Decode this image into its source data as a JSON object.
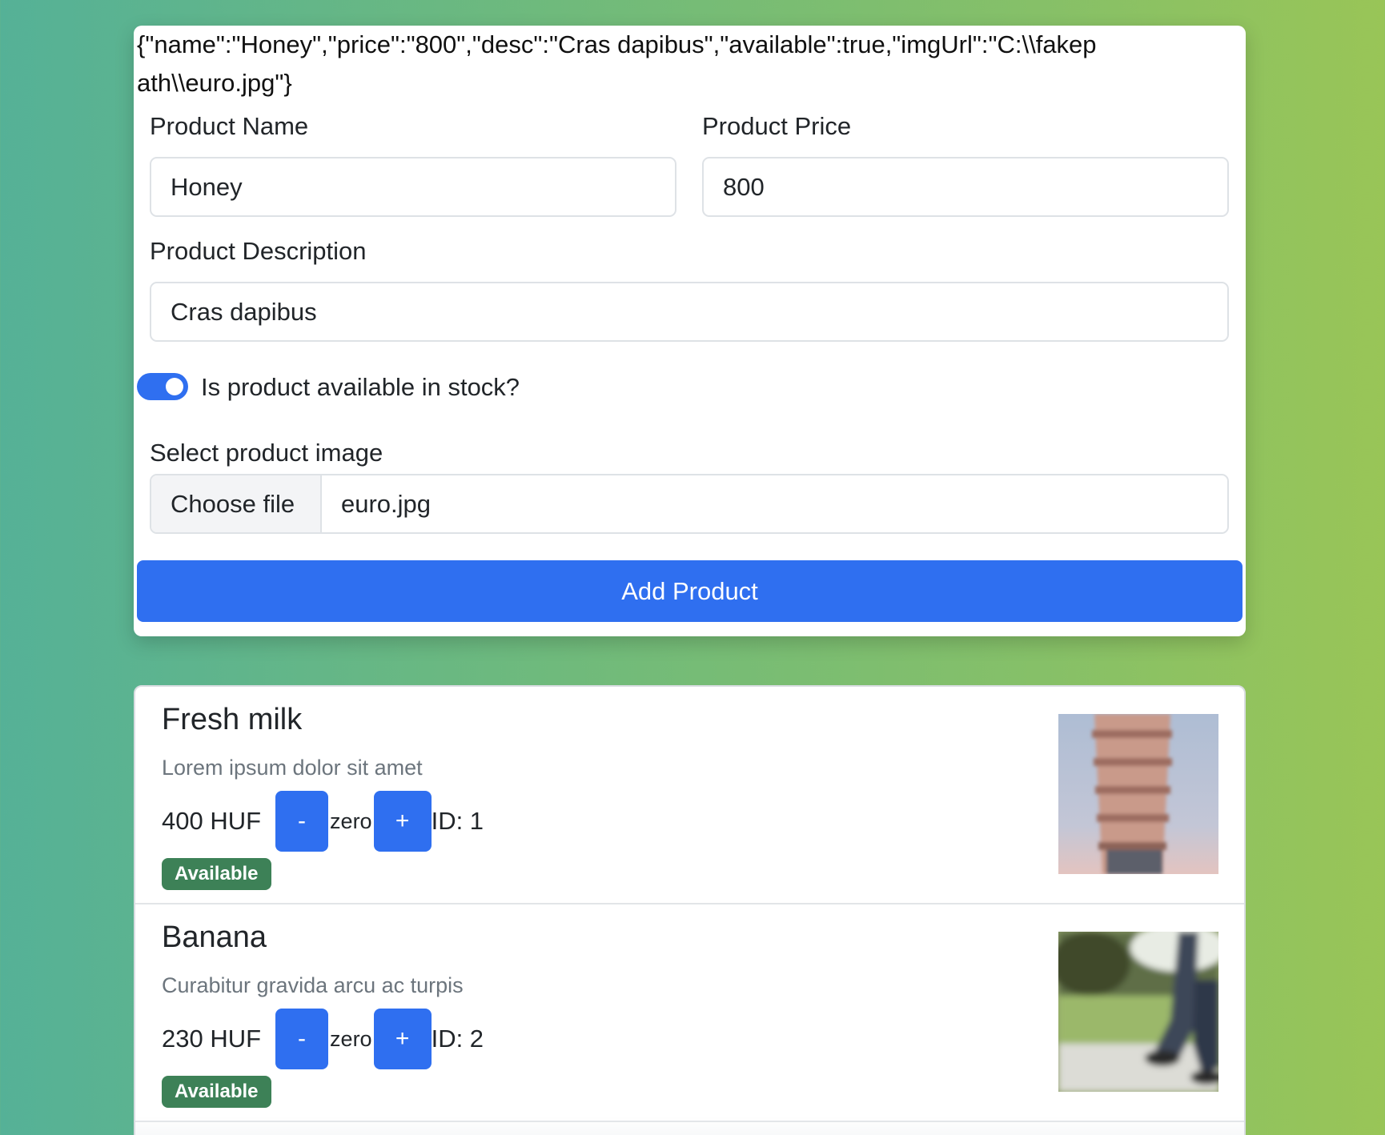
{
  "debug_json": "{\"name\":\"Honey\",\"price\":\"800\",\"desc\":\"Cras dapibus\",\"available\":true,\"imgUrl\":\"C:\\\\fakepath\\\\euro.jpg\"}",
  "form": {
    "name_label": "Product Name",
    "name_value": "Honey",
    "price_label": "Product Price",
    "price_value": "800",
    "desc_label": "Product Description",
    "desc_value": "Cras dapibus",
    "available_label": "Is product available in stock?",
    "available_checked": true,
    "image_label": "Select product image",
    "choose_file_label": "Choose file",
    "file_name": "euro.jpg",
    "submit_label": "Add Product"
  },
  "products": [
    {
      "name": "Fresh milk",
      "desc": "Lorem ipsum dolor sit amet",
      "price": "400 HUF",
      "minus": "-",
      "qty": "zero",
      "plus": "+",
      "id": "ID: 1",
      "badge": "Available",
      "image_icon": "tower-photo"
    },
    {
      "name": "Banana",
      "desc": "Curabitur gravida arcu ac turpis",
      "price": "230 HUF",
      "minus": "-",
      "qty": "zero",
      "plus": "+",
      "id": "ID: 2",
      "badge": "Available",
      "image_icon": "park-walker-photo"
    }
  ],
  "colors": {
    "primary": "#2f6ff0",
    "success_badge": "#3d8157"
  }
}
